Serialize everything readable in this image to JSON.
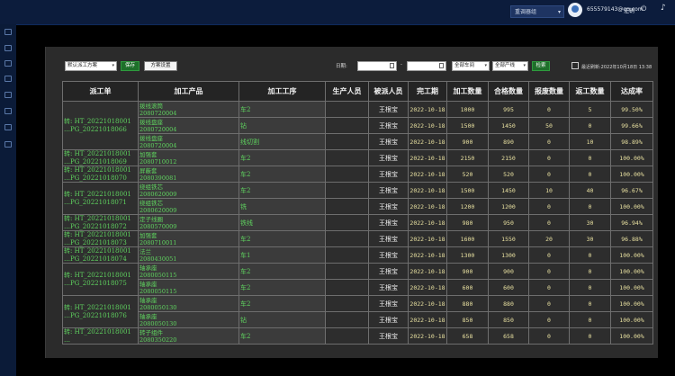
{
  "topbar": {
    "env_label": "重调器组",
    "user": "655579143@qq.com",
    "logout": "注销"
  },
  "toolbar": {
    "scheme_value": "默认派工方案",
    "save_label": "保存",
    "scheme_settings_label": "方案设置",
    "date_label": "日期:",
    "date_separator": "-",
    "workshop_value": "全部车间",
    "line_value": "全部产线",
    "search_label": "检索",
    "refresh_text": "最近刷新:2022年10月18日 13:38"
  },
  "table": {
    "headers": [
      "派工单",
      "加工产品",
      "加工工序",
      "生产人员",
      "被派人员",
      "完工期",
      "加工数量",
      "合格数量",
      "报废数量",
      "返工数量",
      "达成率"
    ],
    "groups": [
      {
        "order": "转: HT_20221018001 …PG_20221018066",
        "rows": [
          {
            "product_name": "拨线滚筒",
            "product_code": "2080720004",
            "process": "车2",
            "producer": "",
            "assignee": "王根宝",
            "finish_date": "2022-10-18",
            "quantity": "1000",
            "qualified": "995",
            "scrap": "0",
            "rework": "5",
            "rate": "99.50%"
          },
          {
            "product_name": "拨线盘座",
            "product_code": "2080720004",
            "process": "钻",
            "producer": "",
            "assignee": "王根宝",
            "finish_date": "2022-10-18",
            "quantity": "1500",
            "qualified": "1450",
            "scrap": "50",
            "rework": "0",
            "rate": "99.66%"
          },
          {
            "product_name": "拨线盘座",
            "product_code": "2080720004",
            "process": "线切割",
            "producer": "",
            "assignee": "王根宝",
            "finish_date": "2022-10-18",
            "quantity": "900",
            "qualified": "890",
            "scrap": "0",
            "rework": "10",
            "rate": "98.89%"
          }
        ]
      },
      {
        "order": "转: HT_20221018001 …PG_20221018069",
        "rows": [
          {
            "product_name": "加强套",
            "product_code": "2080710012",
            "process": "车2",
            "producer": "",
            "assignee": "王根宝",
            "finish_date": "2022-10-18",
            "quantity": "2150",
            "qualified": "2150",
            "scrap": "0",
            "rework": "0",
            "rate": "100.00%"
          }
        ]
      },
      {
        "order": "转: HT_20221018001 …PG_20221018070",
        "rows": [
          {
            "product_name": "屏蔽套",
            "product_code": "2080390081",
            "process": "车2",
            "producer": "",
            "assignee": "王根宝",
            "finish_date": "2022-10-18",
            "quantity": "520",
            "qualified": "520",
            "scrap": "0",
            "rework": "0",
            "rate": "100.00%"
          }
        ]
      },
      {
        "order": "转: HT_20221018001 …PG_20221018071",
        "rows": [
          {
            "product_name": "绕组铁芯",
            "product_code": "2080620009",
            "process": "车2",
            "producer": "",
            "assignee": "王根宝",
            "finish_date": "2022-10-18",
            "quantity": "1500",
            "qualified": "1450",
            "scrap": "10",
            "rework": "40",
            "rate": "96.67%"
          },
          {
            "product_name": "绕组铁芯",
            "product_code": "2080620009",
            "process": "铣",
            "producer": "",
            "assignee": "王根宝",
            "finish_date": "2022-10-18",
            "quantity": "1200",
            "qualified": "1200",
            "scrap": "0",
            "rework": "0",
            "rate": "100.00%"
          }
        ]
      },
      {
        "order": "转: HT_20221018001 …PG_20221018072",
        "rows": [
          {
            "product_name": "定子线圈",
            "product_code": "2080570009",
            "process": "铁线",
            "producer": "",
            "assignee": "王根宝",
            "finish_date": "2022-10-18",
            "quantity": "980",
            "qualified": "950",
            "scrap": "0",
            "rework": "30",
            "rate": "96.94%"
          }
        ]
      },
      {
        "order": "转: HT_20221018001 …PG_20221018073",
        "rows": [
          {
            "product_name": "加强套",
            "product_code": "2080710011",
            "process": "车2",
            "producer": "",
            "assignee": "王根宝",
            "finish_date": "2022-10-18",
            "quantity": "1600",
            "qualified": "1550",
            "scrap": "20",
            "rework": "30",
            "rate": "96.88%"
          }
        ]
      },
      {
        "order": "转: HT_20221018001 …PG_20221018074",
        "rows": [
          {
            "product_name": "法兰",
            "product_code": "2080430051",
            "process": "车1",
            "producer": "",
            "assignee": "王根宝",
            "finish_date": "2022-10-18",
            "quantity": "1300",
            "qualified": "1300",
            "scrap": "0",
            "rework": "0",
            "rate": "100.00%"
          }
        ]
      },
      {
        "order": "转: HT_20221018001 …PG_20221018075",
        "rows": [
          {
            "product_name": "轴承座",
            "product_code": "2080050115",
            "process": "车2",
            "producer": "",
            "assignee": "王根宝",
            "finish_date": "2022-10-18",
            "quantity": "900",
            "qualified": "900",
            "scrap": "0",
            "rework": "0",
            "rate": "100.00%"
          },
          {
            "product_name": "轴承座",
            "product_code": "2080050115",
            "process": "车2",
            "producer": "",
            "assignee": "王根宝",
            "finish_date": "2022-10-18",
            "quantity": "600",
            "qualified": "600",
            "scrap": "0",
            "rework": "0",
            "rate": "100.00%"
          }
        ]
      },
      {
        "order": "转: HT_20221018001 …PG_20221018076",
        "rows": [
          {
            "product_name": "轴承座",
            "product_code": "2080050130",
            "process": "车2",
            "producer": "",
            "assignee": "王根宝",
            "finish_date": "2022-10-18",
            "quantity": "880",
            "qualified": "880",
            "scrap": "0",
            "rework": "0",
            "rate": "100.00%"
          },
          {
            "product_name": "轴承座",
            "product_code": "2080050130",
            "process": "钻",
            "producer": "",
            "assignee": "王根宝",
            "finish_date": "2022-10-18",
            "quantity": "850",
            "qualified": "850",
            "scrap": "0",
            "rework": "0",
            "rate": "100.00%"
          }
        ]
      },
      {
        "order": "转: HT_20221018001 …",
        "rows": [
          {
            "product_name": "转子组件",
            "product_code": "2080350220",
            "process": "车2",
            "producer": "",
            "assignee": "王根宝",
            "finish_date": "2022-10-18",
            "quantity": "658",
            "qualified": "658",
            "scrap": "0",
            "rework": "0",
            "rate": "100.00%"
          }
        ]
      }
    ]
  }
}
